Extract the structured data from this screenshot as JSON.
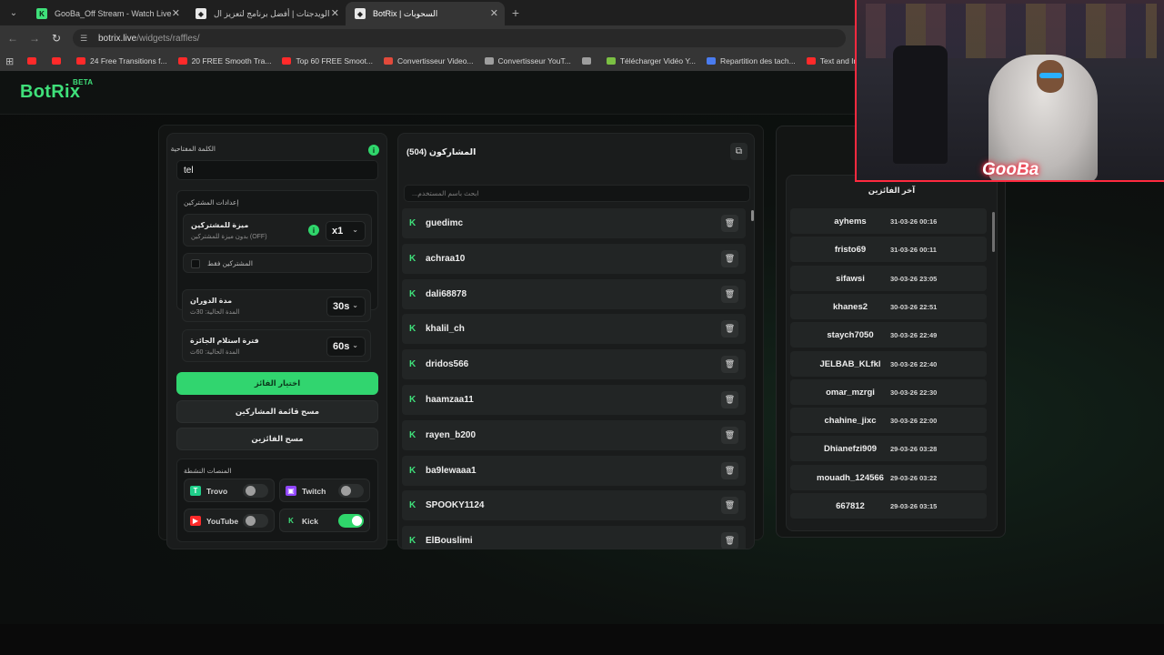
{
  "browser": {
    "tabs": [
      {
        "title": "GooBa_Off Stream - Watch Live",
        "active": false
      },
      {
        "title": "الويدجتات | أفضل برنامج لتعزيز ال",
        "active": false
      },
      {
        "title": "BotRix | السحوبات",
        "active": true
      }
    ],
    "new_tab": "+",
    "url_host": "botrix.live",
    "url_path": "/widgets/raffles/",
    "bookmarks": [
      {
        "label": "",
        "color": "#ff2a2a"
      },
      {
        "label": "",
        "color": "#ff2a2a"
      },
      {
        "label": "24 Free Transitions f...",
        "color": "#ff2a2a"
      },
      {
        "label": "20 FREE Smooth Tra...",
        "color": "#ff2a2a"
      },
      {
        "label": "Top 60 FREE Smoot...",
        "color": "#ff2a2a"
      },
      {
        "label": "Convertisseur Video...",
        "color": "#e24a3b"
      },
      {
        "label": "Convertisseur YouT...",
        "color": "#9e9e9e"
      },
      {
        "label": "",
        "color": "#9e9e9e"
      },
      {
        "label": "Télécharger Vidéo Y...",
        "color": "#7bc043"
      },
      {
        "label": "Repartition des tach...",
        "color": "#4a7cf0"
      },
      {
        "label": "Text and Image ani...",
        "color": "#ff2a2a"
      }
    ]
  },
  "app": {
    "logo": "BotRix",
    "logo_badge": "BETA",
    "accent": "#31d56f"
  },
  "settings": {
    "keyword_label": "الكلمة المفتاحية",
    "keyword_info": "i",
    "keyword_value": "tel",
    "subscribers_section": "إعدادات المشتركين",
    "sub_benefit": {
      "title": "ميزة للمشتركين",
      "subtitle": "بدون ميزة للمشتركين (OFF)",
      "info": "i",
      "value": "x1"
    },
    "subs_only": "المشتركين فقط",
    "spin_duration": {
      "title": "مدة الدوران",
      "subtitle": "المدة الحالية: 30ث",
      "value": "30s"
    },
    "claim_time": {
      "title": "فترة استلام الجائزة",
      "subtitle": "المدة الحالية: 60ث",
      "value": "60s"
    },
    "pick_winner": "اختيار الفائز",
    "clear_participants": "مسح قائمة المشاركين",
    "clear_winners": "مسح الفائزين",
    "platforms_title": "المنصات النشطة",
    "platforms": [
      {
        "name": "Trovo",
        "enabled": false,
        "color": "#1fcf8a",
        "icon": "trovo-icon"
      },
      {
        "name": "Twitch",
        "enabled": false,
        "color": "#9146ff",
        "icon": "twitch-icon"
      },
      {
        "name": "YouTube",
        "enabled": false,
        "color": "#ff2a2a",
        "icon": "youtube-icon"
      },
      {
        "name": "Kick",
        "enabled": true,
        "color": "#3fe07a",
        "icon": "kick-icon"
      }
    ]
  },
  "participants": {
    "title": "المشاركون (504)",
    "search_placeholder": "ابحث باسم المستخدم...",
    "list": [
      "guedimc",
      "achraa10",
      "dali68878",
      "khalil_ch",
      "dridos566",
      "haamzaa11",
      "rayen_b200",
      "ba9lewaaa1",
      "SPOOKY1124",
      "ElBouslimi"
    ]
  },
  "winners": {
    "title": "آخر الفائزين",
    "list": [
      {
        "name": "ayhems",
        "date": "31-03-26 00:16"
      },
      {
        "name": "fristo69",
        "date": "31-03-26 00:11"
      },
      {
        "name": "sifawsi",
        "date": "30-03-26 23:05"
      },
      {
        "name": "khanes2",
        "date": "30-03-26 22:51"
      },
      {
        "name": "staych7050",
        "date": "30-03-26 22:49"
      },
      {
        "name": "JELBAB_KLfkl",
        "date": "30-03-26 22:40"
      },
      {
        "name": "omar_mzrgi",
        "date": "30-03-26 22:30"
      },
      {
        "name": "chahine_jixc",
        "date": "30-03-26 22:00"
      },
      {
        "name": "Dhianefzi909",
        "date": "29-03-26 03:28"
      },
      {
        "name": "mouadh_124566",
        "date": "29-03-26 03:22"
      },
      {
        "name": "667812",
        "date": "29-03-26 03:15"
      }
    ]
  },
  "webcam": {
    "overlay_name": "GooBa"
  }
}
